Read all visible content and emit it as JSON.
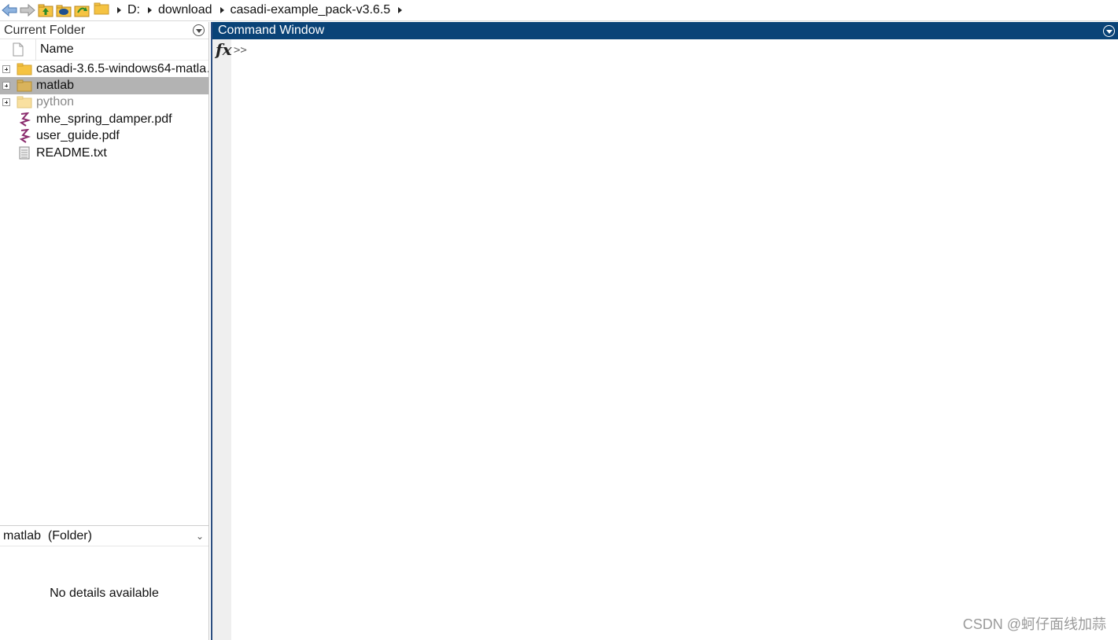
{
  "toolbar": {
    "buttons": [
      {
        "name": "back-button",
        "icon": "back-arrow-icon"
      },
      {
        "name": "forward-button",
        "icon": "forward-arrow-icon"
      },
      {
        "name": "up-folder-button",
        "icon": "up-one-level-icon"
      },
      {
        "name": "browse-folder-button",
        "icon": "browse-folder-icon"
      },
      {
        "name": "refresh-button",
        "icon": "refresh-icon"
      }
    ],
    "path": [
      "D:",
      "download",
      "casadi-example_pack-v3.6.5"
    ]
  },
  "current_folder": {
    "title": "Current Folder",
    "column_name": "Name",
    "items": [
      {
        "label": "casadi-3.6.5-windows64-matla…",
        "type": "folder",
        "expandable": true,
        "selected": false,
        "dim": false
      },
      {
        "label": "matlab",
        "type": "folder",
        "expandable": true,
        "selected": true,
        "dim": false
      },
      {
        "label": "python",
        "type": "folder",
        "expandable": true,
        "selected": false,
        "dim": true
      },
      {
        "label": "mhe_spring_damper.pdf",
        "type": "pdf",
        "expandable": false,
        "selected": false,
        "dim": false
      },
      {
        "label": "user_guide.pdf",
        "type": "pdf",
        "expandable": false,
        "selected": false,
        "dim": false
      },
      {
        "label": "README.txt",
        "type": "txt",
        "expandable": false,
        "selected": false,
        "dim": false
      }
    ],
    "details": {
      "header": "matlab  (Folder)",
      "body": "No details available"
    }
  },
  "command_window": {
    "title": "Command Window",
    "fx_label": "fx",
    "prompt": ">>"
  },
  "watermark": "CSDN @蚵仔面线加蒜",
  "colors": {
    "title_bar": "#0a4377",
    "selected_row": "#b3b3b3",
    "folder": "#f5c342",
    "pdf": "#8b2d6e"
  }
}
